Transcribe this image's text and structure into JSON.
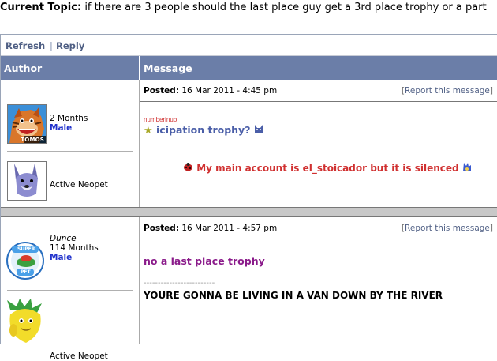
{
  "topic": {
    "label": "Current Topic:",
    "title": "if there are 3 people should the last place guy get a 3rd place trophy or a part"
  },
  "toolbar": {
    "refresh": "Refresh",
    "separator": "|",
    "reply": "Reply"
  },
  "table": {
    "author_header": "Author",
    "message_header": "Message"
  },
  "posts": [
    {
      "author": {
        "name": "",
        "age": "2 Months",
        "gender": "Male",
        "avatar_label": "TOMOS",
        "pet_status": "Active Neopet"
      },
      "posted_label": "Posted:",
      "posted_date": "16 Mar 2011 - 4:45 pm",
      "report": {
        "open": "[",
        "label": "Report this message",
        "close": "]"
      },
      "message": {
        "quote_user": "numberinub",
        "line1": "icipation trophy?",
        "line2": "My main account is el_stoicador but it is silenced"
      }
    },
    {
      "author": {
        "name": "Dunce",
        "age": "114 Months",
        "gender": "Male",
        "avatar_label_top": "SUPER",
        "avatar_label_bottom": "PET",
        "pet_status": "Active Neopet"
      },
      "posted_label": "Posted:",
      "posted_date": "16 Mar 2011 - 4:57 pm",
      "report": {
        "open": "[",
        "label": "Report this message",
        "close": "]"
      },
      "message": {
        "line1": "no a last place trophy",
        "rule": "-------------------------",
        "line2": "YOURE GONNA BE LIVING IN A VAN DOWN BY THE RIVER"
      }
    }
  ],
  "colors": {
    "header_bg": "#6b7ea8",
    "link": "#4f5f84",
    "post1_text": "#4a5ea8",
    "post1_alert": "#d03030",
    "post2_text": "#8a1a8a"
  }
}
